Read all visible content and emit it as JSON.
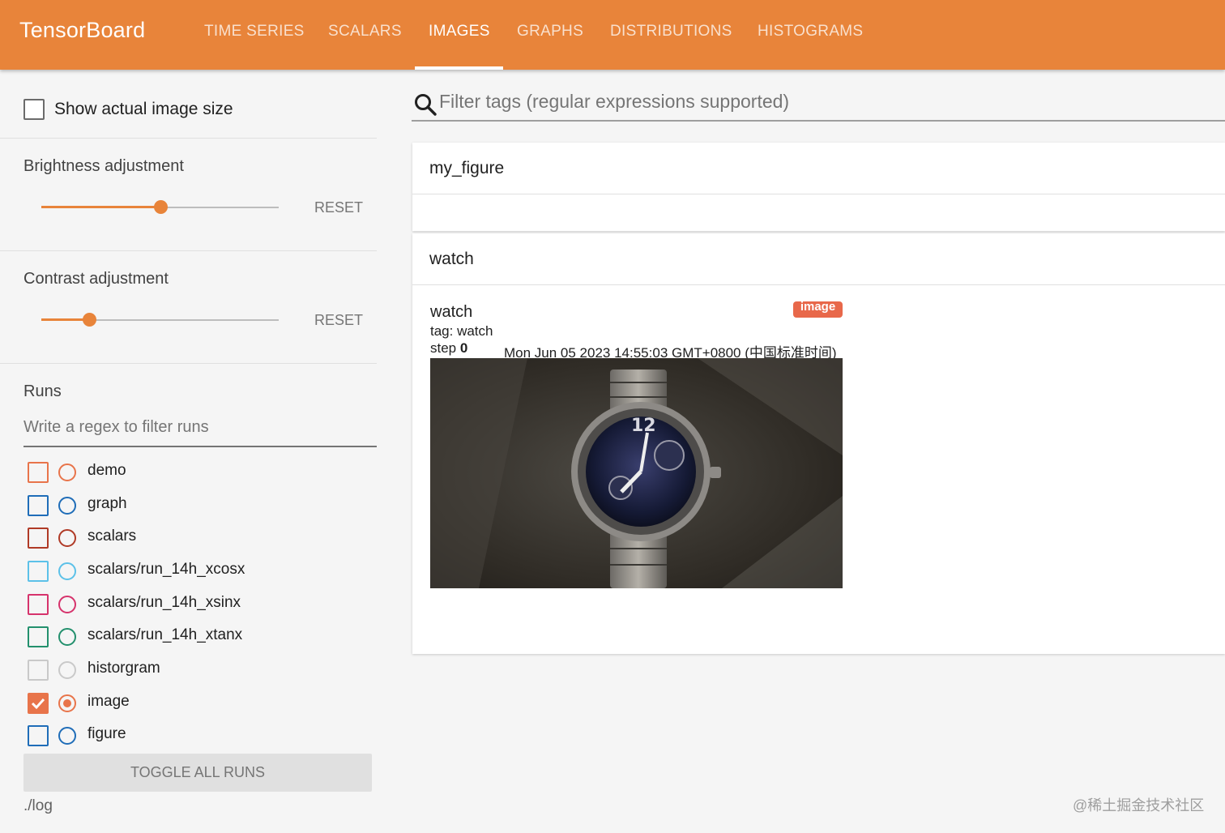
{
  "header": {
    "brand": "TensorBoard",
    "tabs": [
      {
        "label": "TIME SERIES",
        "active": false
      },
      {
        "label": "SCALARS",
        "active": false
      },
      {
        "label": "IMAGES",
        "active": true
      },
      {
        "label": "GRAPHS",
        "active": false
      },
      {
        "label": "DISTRIBUTIONS",
        "active": false
      },
      {
        "label": "HISTOGRAMS",
        "active": false
      }
    ],
    "accent_color": "#e8843a"
  },
  "sidebar": {
    "show_actual_size_label": "Show actual image size",
    "show_actual_size_checked": false,
    "brightness": {
      "title": "Brightness adjustment",
      "value_fraction": 0.5,
      "reset_label": "RESET"
    },
    "contrast": {
      "title": "Contrast adjustment",
      "value_fraction": 0.2,
      "reset_label": "RESET"
    },
    "runs": {
      "title": "Runs",
      "filter_placeholder": "Write a regex to filter runs",
      "items": [
        {
          "name": "demo",
          "color": "#e8744a",
          "checked": false
        },
        {
          "name": "graph",
          "color": "#1f6db8",
          "checked": false
        },
        {
          "name": "scalars",
          "color": "#b03a26",
          "checked": false
        },
        {
          "name": "scalars/run_14h_xcosx",
          "color": "#5cc1e8",
          "checked": false
        },
        {
          "name": "scalars/run_14h_xsinx",
          "color": "#d6336c",
          "checked": false
        },
        {
          "name": "scalars/run_14h_xtanx",
          "color": "#23906d",
          "checked": false
        },
        {
          "name": "historgram",
          "color": "#c9c9c9",
          "checked": false
        },
        {
          "name": "image",
          "color": "#e8744a",
          "checked": true
        },
        {
          "name": "figure",
          "color": "#1f6db8",
          "checked": false
        }
      ],
      "toggle_all_label": "TOGGLE ALL RUNS",
      "logdir": "./log"
    }
  },
  "main": {
    "filter_placeholder": "Filter tags (regular expressions supported)",
    "cards": [
      {
        "title": "my_figure"
      },
      {
        "title": "watch",
        "image": {
          "title": "watch",
          "tag_line": "tag: watch",
          "step_label": "step",
          "step_value": "0",
          "timestamp": "Mon Jun 05 2023 14:55:03 GMT+0800 (中国标准时间)",
          "run_chip": "image",
          "alt": "photo of a wristwatch"
        }
      }
    ]
  },
  "watermark": "@稀土掘金技术社区"
}
